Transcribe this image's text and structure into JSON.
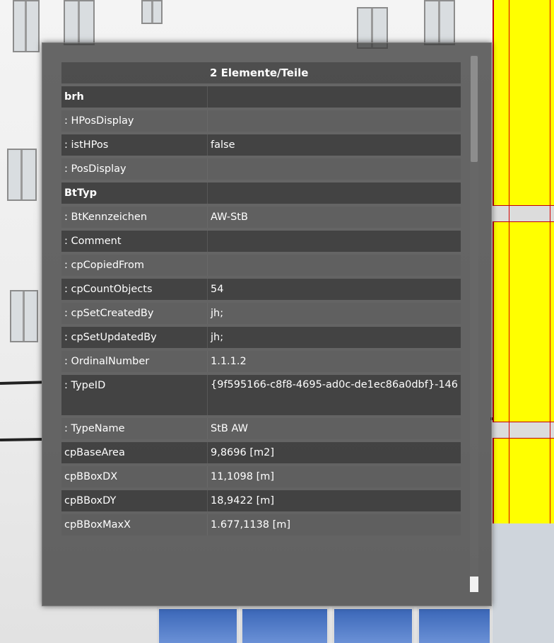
{
  "tooltip": {
    "header": "2 Elemente/Teile",
    "rows": [
      {
        "key": "brh",
        "value": "",
        "kind": "group"
      },
      {
        "key": ": HPosDisplay",
        "value": "",
        "kind": "prop"
      },
      {
        "key": ": istHPos",
        "value": "false",
        "kind": "prop"
      },
      {
        "key": ": PosDisplay",
        "value": "",
        "kind": "prop"
      },
      {
        "key": "BtTyp",
        "value": "",
        "kind": "group"
      },
      {
        "key": ": BtKennzeichen",
        "value": "AW-StB",
        "kind": "prop"
      },
      {
        "key": ": Comment",
        "value": "",
        "kind": "prop"
      },
      {
        "key": ": cpCopiedFrom",
        "value": "",
        "kind": "prop"
      },
      {
        "key": ": cpCountObjects",
        "value": "54",
        "kind": "prop"
      },
      {
        "key": ": cpSetCreatedBy",
        "value": "jh;",
        "kind": "prop"
      },
      {
        "key": ": cpSetUpdatedBy",
        "value": "jh;",
        "kind": "prop"
      },
      {
        "key": ": OrdinalNumber",
        "value": "1.1.1.2",
        "kind": "prop"
      },
      {
        "key": ": TypeID",
        "value": "{9f595166-c8f8-4695-ad0c-de1ec86a0dbf}-146",
        "kind": "prop"
      },
      {
        "key": ": TypeName",
        "value": "StB AW",
        "kind": "prop"
      },
      {
        "key": "cpBaseArea",
        "value": "9,8696 [m2]",
        "kind": "prop"
      },
      {
        "key": "cpBBoxDX",
        "value": "11,1098 [m]",
        "kind": "prop"
      },
      {
        "key": "cpBBoxDY",
        "value": "18,9422 [m]",
        "kind": "prop"
      },
      {
        "key": "cpBBoxMaxX",
        "value": "1.677,1138 [m]",
        "kind": "prop"
      }
    ]
  },
  "colors": {
    "panel": "#3e3e3e",
    "text": "#ffffff",
    "wall_highlight": "#ffff00",
    "edge_red": "#d40000",
    "glass_blue": "#3b67b8"
  }
}
